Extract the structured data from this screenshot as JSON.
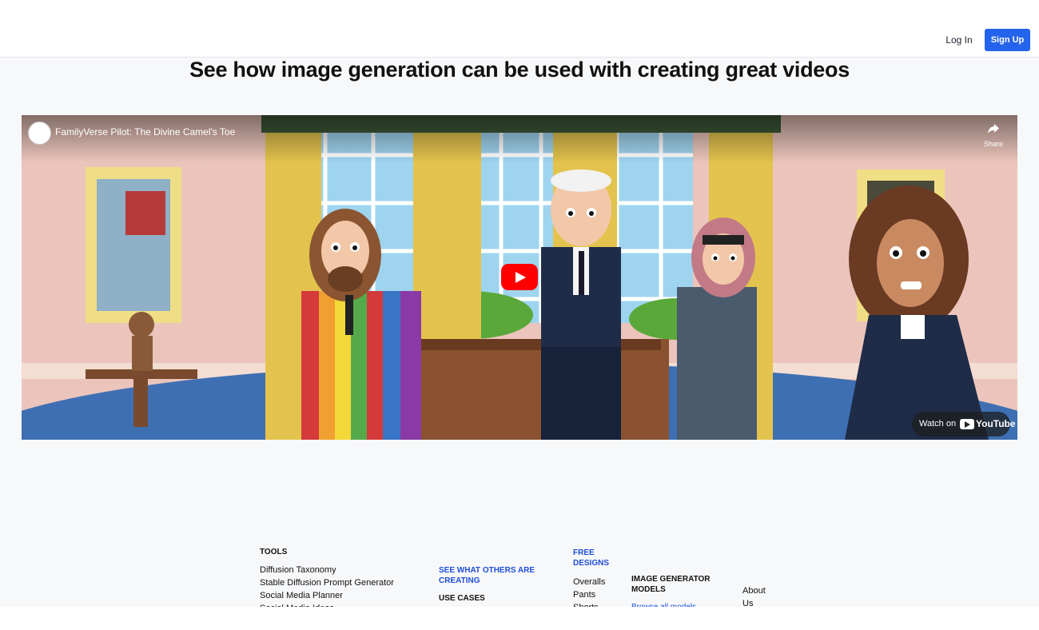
{
  "header": {
    "login_label": "Log In",
    "signup_label": "Sign Up",
    "accent": "#2463eb"
  },
  "main": {
    "headline": "See how image generation can be used with creating great videos"
  },
  "video": {
    "title": "FamilyVerse Pilot: The Divine Camel's Toe",
    "share_label": "Share",
    "watch_on": "Watch on",
    "youtube_wordmark": "YouTube",
    "play_color": "#ff0000"
  },
  "footer": {
    "tools_heading": "TOOLS",
    "tools": [
      "Diffusion Taxonomy",
      "Stable Diffusion Prompt Generator",
      "Social Media Planner",
      "Social Media Ideas"
    ],
    "see_others": "SEE WHAT OTHERS ARE CREATING",
    "use_cases_heading": "USE CASES",
    "free_designs": "FREE DESIGNS",
    "designs": [
      "Overalls",
      "Pants",
      "Shorts"
    ],
    "models_heading": "IMAGE GENERATOR MODELS",
    "browse_models": "Browse all models",
    "about": "About Us"
  }
}
